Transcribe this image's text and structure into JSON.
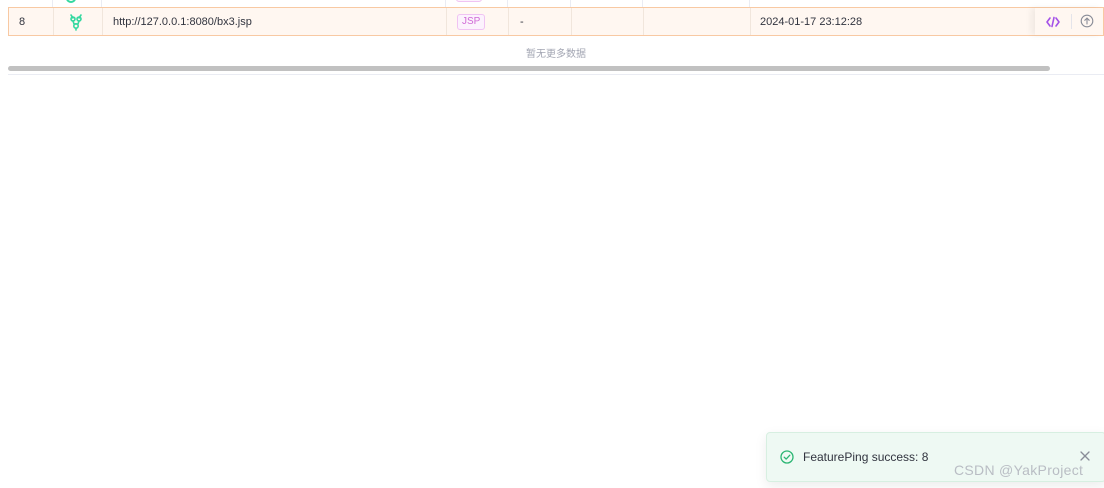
{
  "table": {
    "row": {
      "index": "8",
      "url": "http://127.0.0.1:8080/bx3.jsp",
      "type_tag": "JSP",
      "status": "-",
      "time": "2024-01-17 23:12:28"
    },
    "no_more_text": "暂无更多数据"
  },
  "icons": {
    "row_icon": "trojan-horse-icon",
    "code_action": "code-icon",
    "upload_action": "arrow-up-circle-icon",
    "toast_status": "check-circle-icon",
    "toast_close": "close-icon"
  },
  "notification": {
    "message": "FeaturePing success: 8"
  },
  "watermark": "CSDN @YakProject",
  "colors": {
    "row_highlight_bg": "#fff7f1",
    "row_highlight_border": "#f8c9a3",
    "tag_text": "#d06ad6",
    "icon_green": "#35d8a0",
    "code_icon": "#a451e8",
    "toast_bg": "#eef9f3"
  }
}
